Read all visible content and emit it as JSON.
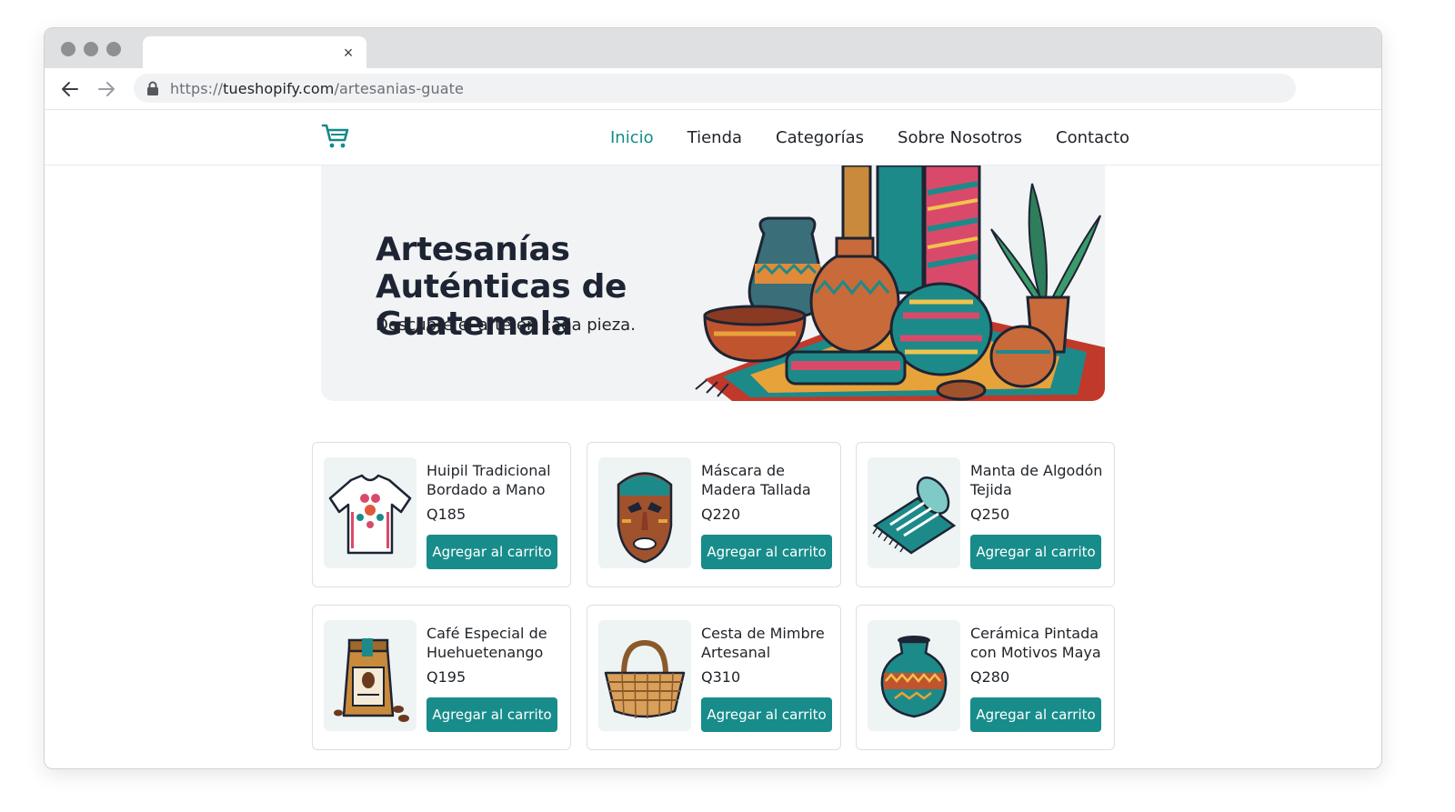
{
  "browser": {
    "tab_close": "×",
    "url_scheme": "https://",
    "url_domain": "tueshopify.com",
    "url_path": "/artesanias-guate"
  },
  "header": {
    "logo_icon": "shopping-cart-icon",
    "nav": [
      {
        "label": "Inicio",
        "active": true
      },
      {
        "label": "Tienda",
        "active": false
      },
      {
        "label": "Categorías",
        "active": false
      },
      {
        "label": "Sobre Nosotros",
        "active": false
      },
      {
        "label": "Contacto",
        "active": false
      }
    ]
  },
  "hero": {
    "title": "Artesanías Auténticas de Guatemala",
    "subtitle": "Descubre el arte en cada pieza."
  },
  "products": [
    {
      "name": "Huipil Tradicional Bordado a Mano",
      "price": "Q185",
      "button": "Agregar al carrito",
      "icon": "huipil-shirt-icon"
    },
    {
      "name": "Máscara de Madera Tallada",
      "price": "Q220",
      "button": "Agregar al carrito",
      "icon": "wooden-mask-icon"
    },
    {
      "name": "Manta de Algodón Tejida",
      "price": "Q250",
      "button": "Agregar al carrito",
      "icon": "woven-blanket-icon"
    },
    {
      "name": "Café Especial de Huehuetenango",
      "price": "Q195",
      "button": "Agregar al carrito",
      "icon": "coffee-bag-icon"
    },
    {
      "name": "Cesta de Mimbre Artesanal",
      "price": "Q310",
      "button": "Agregar al carrito",
      "icon": "wicker-basket-icon"
    },
    {
      "name": "Cerámica Pintada con Motivos Maya",
      "price": "Q280",
      "button": "Agregar al carrito",
      "icon": "painted-vase-icon"
    }
  ],
  "colors": {
    "accent": "#178c8a",
    "hero_bg": "#f2f3f4",
    "text": "#1f2328"
  }
}
